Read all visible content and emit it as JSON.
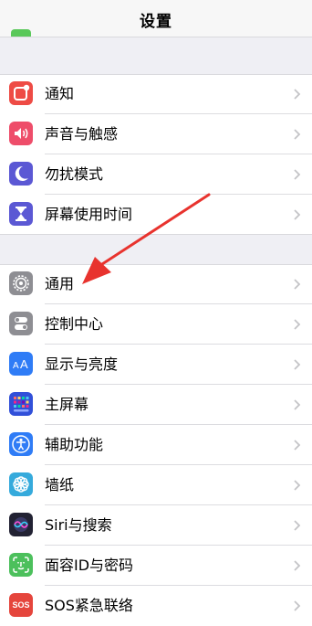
{
  "header": {
    "title": "设置"
  },
  "section1": {
    "items": [
      {
        "label": "通知",
        "icon": "notifications-icon",
        "color": "#ee4b45"
      },
      {
        "label": "声音与触感",
        "icon": "sound-icon",
        "color": "#ee4d6a"
      },
      {
        "label": "勿扰模式",
        "icon": "moon-icon",
        "color": "#5b58d4"
      },
      {
        "label": "屏幕使用时间",
        "icon": "hourglass-icon",
        "color": "#5b58d4"
      }
    ]
  },
  "section2": {
    "items": [
      {
        "label": "通用",
        "icon": "gear-icon",
        "color": "#8e8e93"
      },
      {
        "label": "控制中心",
        "icon": "toggles-icon",
        "color": "#8e8e93"
      },
      {
        "label": "显示与亮度",
        "icon": "text-size-icon",
        "color": "#2f7cf6"
      },
      {
        "label": "主屏幕",
        "icon": "home-grid-icon",
        "color": "#3150d9"
      },
      {
        "label": "辅助功能",
        "icon": "accessibility-icon",
        "color": "#2f7cf6"
      },
      {
        "label": "墙纸",
        "icon": "flower-icon",
        "color": "#35aadc"
      },
      {
        "label": "Siri与搜索",
        "icon": "siri-icon",
        "color": "#222233"
      },
      {
        "label": "面容ID与密码",
        "icon": "face-id-icon",
        "color": "#4cc05c"
      },
      {
        "label": "SOS紧急联络",
        "icon": "sos-icon",
        "color": "#e5453c",
        "icon_text": "SOS"
      }
    ]
  },
  "annotation": {
    "arrow_color": "#e8332e"
  }
}
